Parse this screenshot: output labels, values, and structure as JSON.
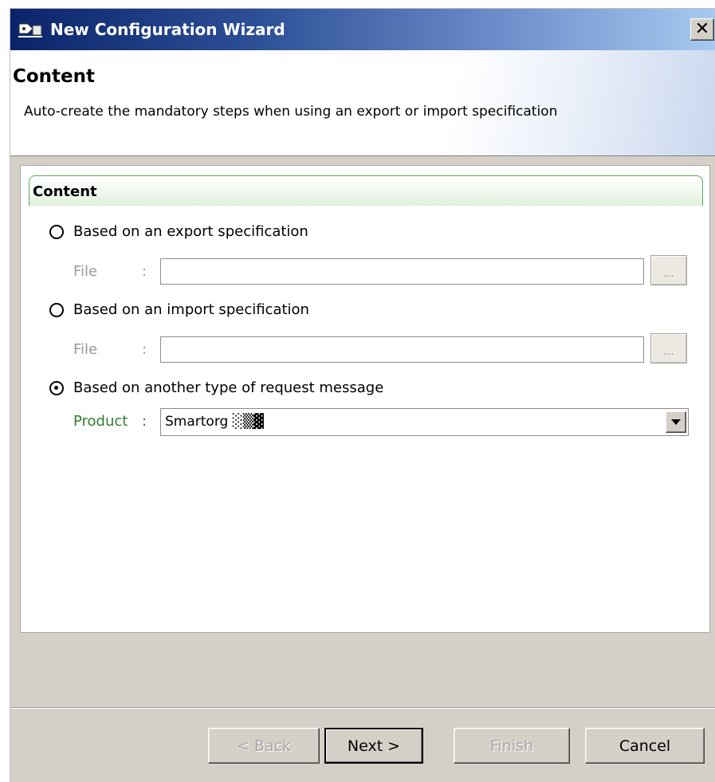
{
  "window": {
    "title": "New Configuration Wizard",
    "close_label": "✕"
  },
  "header": {
    "title": "Content",
    "description": "Auto-create the mandatory steps when using an export or import specification"
  },
  "content": {
    "group_title": "Content",
    "options": [
      {
        "label": "Based on an export specification",
        "selected": false
      },
      {
        "label": "Based on an import specification",
        "selected": false
      },
      {
        "label": "Based on another type of request message",
        "selected": true
      }
    ],
    "file_fields": [
      {
        "label": "File",
        "separator": ":",
        "value": "",
        "browse_label": "..."
      },
      {
        "label": "File",
        "separator": ":",
        "value": "",
        "browse_label": "..."
      }
    ],
    "product": {
      "label": "Product",
      "separator": ":",
      "value": "Smartorg ░▒▓"
    }
  },
  "buttons": {
    "back": "< Back",
    "next": "Next >",
    "finish": "Finish",
    "cancel": "Cancel"
  },
  "colors": {
    "titlebar_start": "#0a246a",
    "titlebar_end": "#a6caf0",
    "group_border": "#5fa660",
    "product_label": "#2f7d2f",
    "window_bg": "#d4d0c8"
  }
}
